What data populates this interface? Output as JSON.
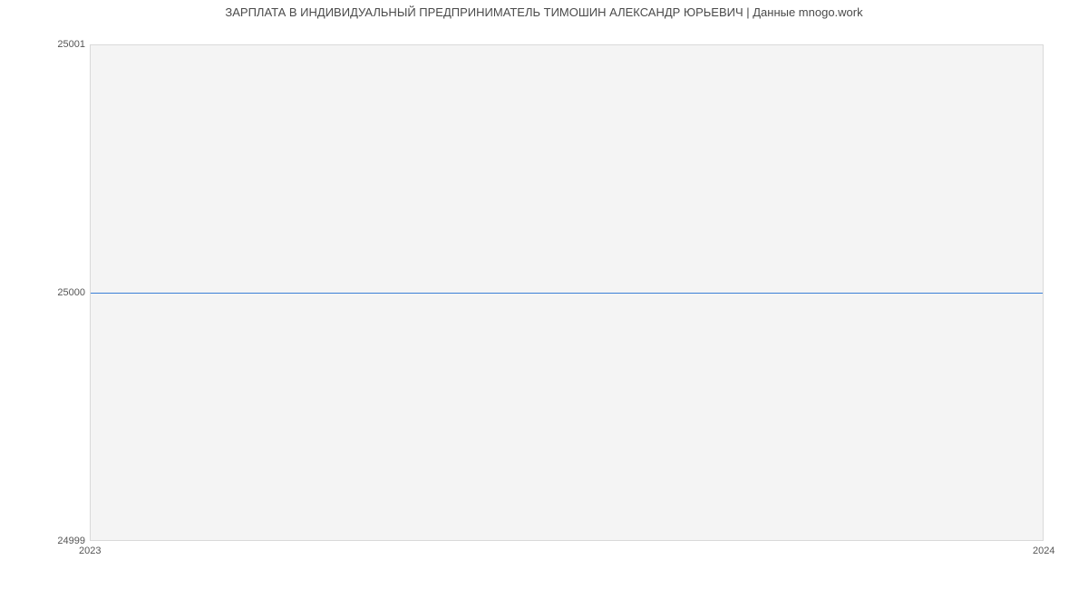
{
  "chart_data": {
    "type": "line",
    "title": "ЗАРПЛАТА В ИНДИВИДУАЛЬНЫЙ ПРЕДПРИНИМАТЕЛЬ ТИМОШИН АЛЕКСАНДР ЮРЬЕВИЧ | Данные mnogo.work",
    "x": [
      2023,
      2024
    ],
    "values": [
      25000,
      25000
    ],
    "xlabel": "",
    "ylabel": "",
    "ylim": [
      24999,
      25001
    ],
    "xlim": [
      2023,
      2024
    ],
    "y_ticks": [
      24999,
      25000,
      25001
    ],
    "x_ticks": [
      2023,
      2024
    ],
    "line_color": "#3b7fd6",
    "plot_bg": "#f4f4f4"
  },
  "ticks": {
    "y0": "24999",
    "y1": "25000",
    "y2": "25001",
    "x0": "2023",
    "x1": "2024"
  }
}
